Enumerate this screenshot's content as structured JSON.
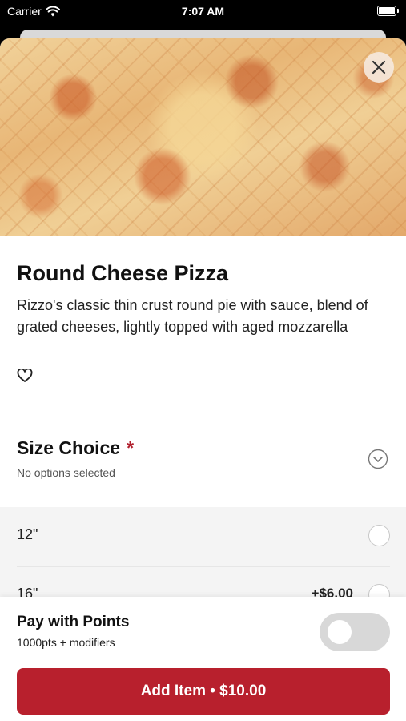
{
  "status_bar": {
    "carrier": "Carrier",
    "time": "7:07 AM"
  },
  "item": {
    "title": "Round Cheese Pizza",
    "description": "Rizzo's classic thin crust round pie with sauce, blend of grated cheeses, lightly topped with aged mozzarella",
    "favorited": false
  },
  "size_choice": {
    "title": "Size Choice",
    "required_marker": "*",
    "subtitle": "No options selected",
    "options": [
      {
        "label": "12\"",
        "price": "",
        "selected": false
      },
      {
        "label": "16\"",
        "price": "+$6.00",
        "selected": false
      }
    ]
  },
  "footer": {
    "points_title": "Pay with Points",
    "points_subtitle": "1000pts + modifiers",
    "points_enabled": false,
    "add_button_label": "Add Item • $10.00"
  },
  "colors": {
    "accent": "#b8202d",
    "required": "#b1202e"
  },
  "icons": {
    "close": "close-icon",
    "favorite": "heart-icon",
    "expand": "chevron-down-icon",
    "wifi": "wifi-icon",
    "battery": "battery-icon"
  }
}
